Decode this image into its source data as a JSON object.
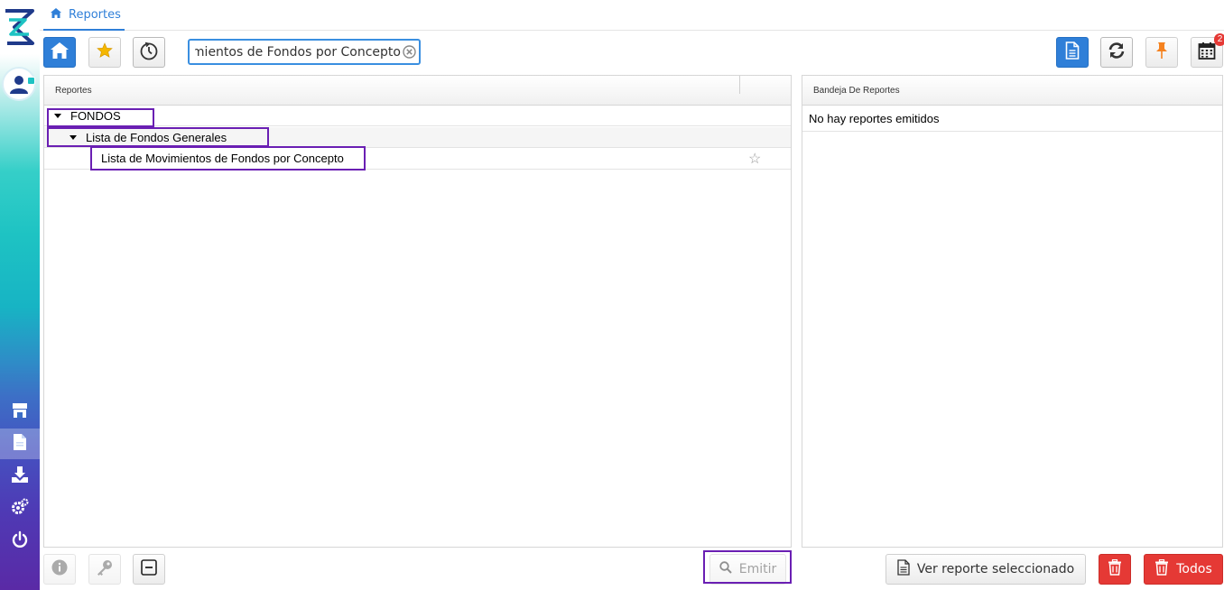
{
  "breadcrumb": {
    "label": "Reportes"
  },
  "search": {
    "value": "Lista de Movimientos de Fondos por Concepto"
  },
  "notifications": {
    "count": "2"
  },
  "reports_panel": {
    "header": "Reportes",
    "tree": [
      {
        "level": 0,
        "label": "FONDOS",
        "expanded": true
      },
      {
        "level": 1,
        "label": "Lista de Fondos Generales",
        "expanded": true
      },
      {
        "level": 2,
        "label": "Lista de Movimientos de Fondos por Concepto",
        "favorite": false
      }
    ]
  },
  "tray_panel": {
    "header": "Bandeja De Reportes",
    "empty_message": "No hay reportes emitidos"
  },
  "bottom": {
    "emit_label": "Emitir",
    "view_selected_label": "Ver reporte seleccionado",
    "delete_all_label": "Todos"
  },
  "colors": {
    "accent": "#2f7fd8",
    "highlight": "#6a1fb3",
    "danger": "#e53935",
    "star": "#f5b700",
    "pin": "#f5821f"
  },
  "icons": {
    "sidebar": [
      "app-logo-icon",
      "user-avatar-icon",
      "store-icon",
      "document-icon",
      "download-icon",
      "settings-icon",
      "power-icon"
    ],
    "toolbar": [
      "home-icon",
      "star-icon",
      "history-icon",
      "document-icon",
      "refresh-icon",
      "pin-icon",
      "calendar-icon"
    ],
    "bottom": [
      "info-icon",
      "key-icon",
      "collapse-icon",
      "search-icon",
      "file-icon",
      "trash-icon"
    ]
  }
}
